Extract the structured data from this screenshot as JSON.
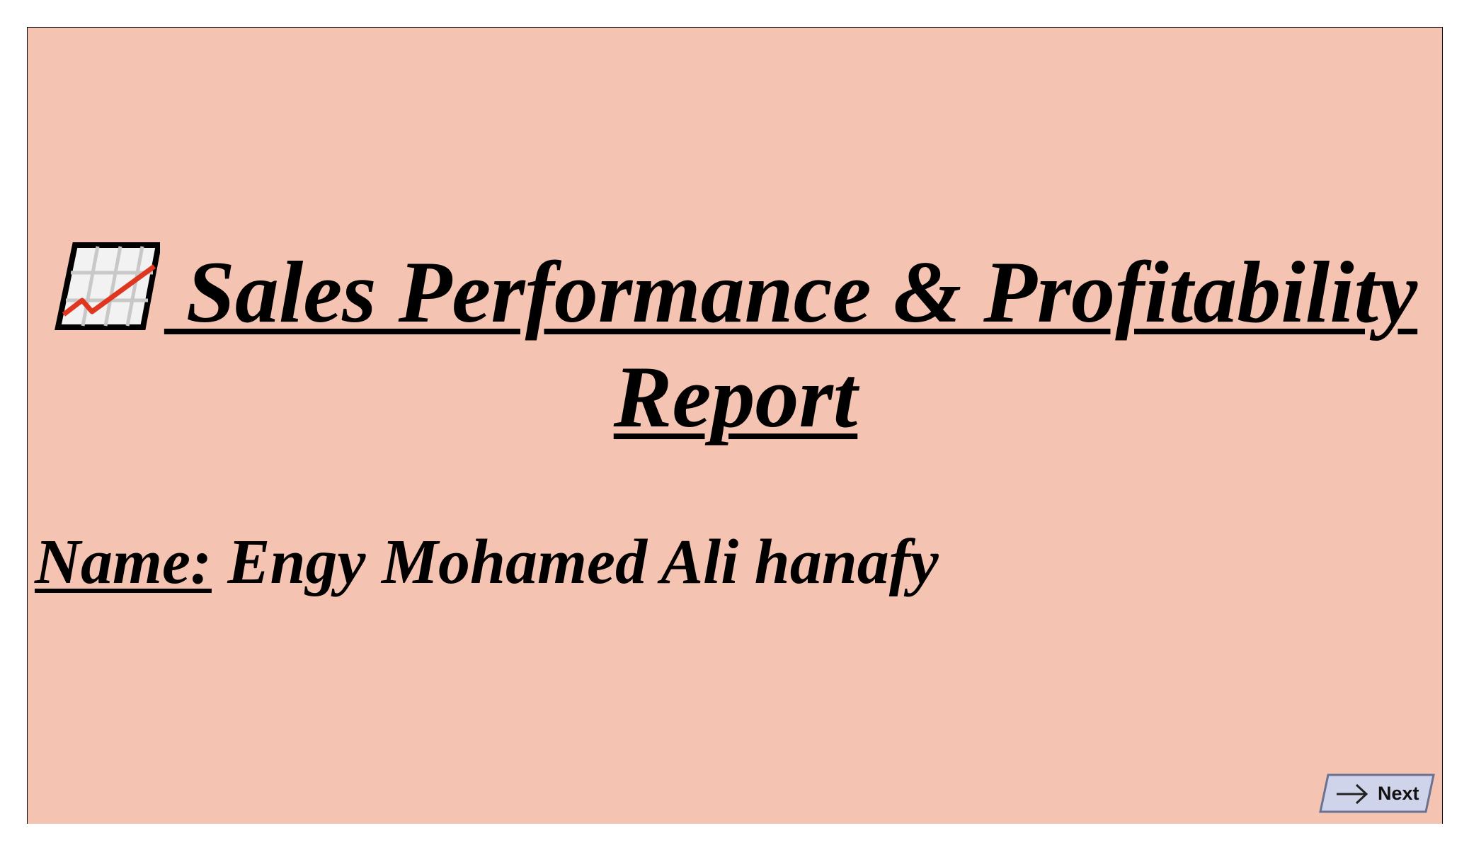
{
  "slide": {
    "title_text": " Sales Performance & Profitability Report",
    "title_icon": "chart-increasing-icon",
    "name_label": "Name:",
    "name_value": " Engy Mohamed Ali hanafy"
  },
  "navigation": {
    "next_label": "Next",
    "next_icon": "arrow-right-icon"
  },
  "colors": {
    "slide_background": "#f5c3b1",
    "button_fill": "#cfd4ea",
    "button_border": "#6b7190",
    "chart_line": "#e0351e"
  }
}
